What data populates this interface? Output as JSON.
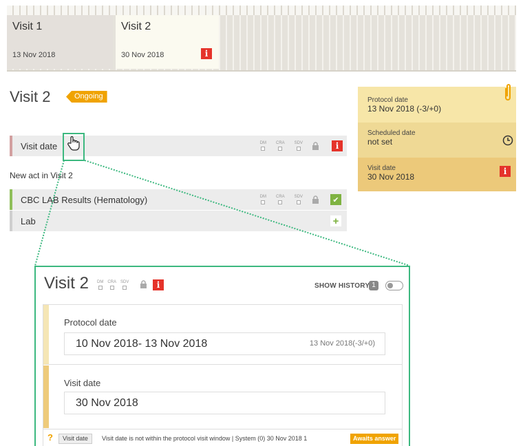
{
  "visits": [
    {
      "name": "Visit 1",
      "date": "13 Nov 2018"
    },
    {
      "name": "Visit 2",
      "date": "30 Nov 2018",
      "info_icon": "i"
    }
  ],
  "page": {
    "title": "Visit 2",
    "status": "Ongoing",
    "status_color": "#f0a300"
  },
  "rows": {
    "visit_date": {
      "label": "Visit date",
      "status_icon": "i"
    },
    "group_label": "New act in Visit 2",
    "cbc": {
      "label": "CBC LAB Results (Hematology)",
      "status_icon": "✔"
    },
    "lab": {
      "label": "Lab",
      "add_icon": "+"
    }
  },
  "flags": {
    "dm": "DM",
    "cra": "CRA",
    "sdv": "SDV"
  },
  "date_panel": {
    "protocol": {
      "label": "Protocol date",
      "value": "13 Nov 2018 (-3/+0)"
    },
    "scheduled": {
      "label": "Scheduled date",
      "value": "not set"
    },
    "visit": {
      "label": "Visit date",
      "value": "30 Nov 2018",
      "info_icon": "i"
    }
  },
  "zoom": {
    "title": "Visit 2",
    "info_icon": "i",
    "show_history": "SHOW HISTORY",
    "history_count": "1",
    "protocol_section": {
      "label": "Protocol date",
      "value": "10 Nov 2018- 13 Nov 2018",
      "hint": "13 Nov 2018(-3/+0)"
    },
    "visit_section": {
      "label": "Visit date",
      "value": "30 Nov 2018"
    },
    "query": {
      "question_mark": "?",
      "tag": "Visit date",
      "text": "Visit date is not within the protocol visit window | System (0) 30 Nov 2018 1",
      "status": "Awaits answer"
    }
  },
  "colors": {
    "accent_green": "#3cb87f",
    "info_red": "#e5332a",
    "ok_green": "#7fb342",
    "warning_orange": "#f0a300"
  },
  "icons": [
    "info-icon",
    "lock-icon",
    "check-icon",
    "add-icon",
    "paperclip-icon",
    "clock-icon",
    "hand-cursor-icon",
    "question-icon"
  ]
}
